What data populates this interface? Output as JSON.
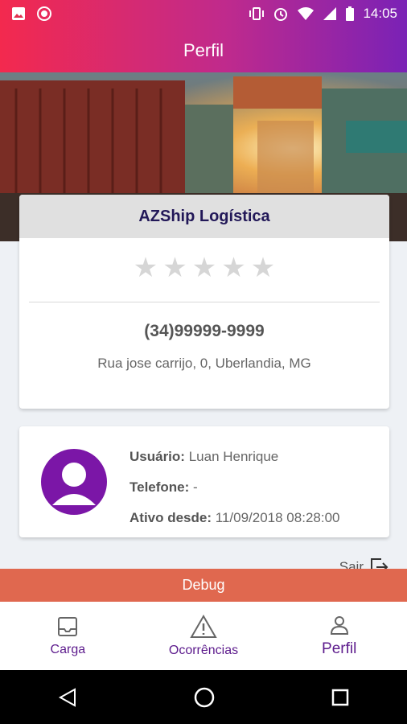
{
  "status": {
    "time": "14:05"
  },
  "appbar": {
    "title": "Perfil"
  },
  "company": {
    "name": "AZShip Logística",
    "rating": 0,
    "rating_max": 5,
    "phone": "(34)99999-9999",
    "address": "Rua jose carrijo, 0, Uberlandia, MG"
  },
  "user": {
    "label_user": "Usuário:",
    "name": "Luan Henrique",
    "label_phone": "Telefone:",
    "phone": "-",
    "label_active": "Ativo desde:",
    "active_since": "11/09/2018 08:28:00"
  },
  "actions": {
    "logout": "Sair",
    "debug": "Debug"
  },
  "nav": {
    "cargo": "Carga",
    "occurrences": "Ocorrências",
    "profile": "Perfil"
  },
  "colors": {
    "accent": "#7b16a7",
    "gradient_start": "#f3294e",
    "gradient_end": "#7a22b6",
    "debug": "#e0684f"
  }
}
